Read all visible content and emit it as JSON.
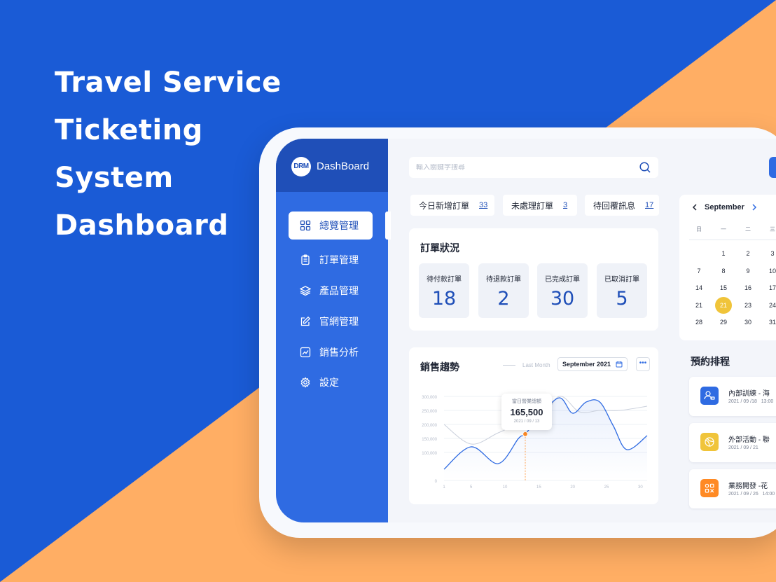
{
  "hero": {
    "lines": [
      "Travel  Service",
      "Ticketing",
      "System",
      "Dashboard"
    ]
  },
  "colors": {
    "primary": "#1A5BD6",
    "accent_orange": "#FFAE64",
    "sidebar": "#2F6BE2",
    "sidebar_header": "#1F4FB8",
    "highlight_yellow": "#F0C43A"
  },
  "sidebar": {
    "logo": "DRM",
    "brand": "DashBoard",
    "items": [
      {
        "label": "總覽管理",
        "icon": "grid-icon",
        "active": true
      },
      {
        "label": "訂單管理",
        "icon": "clipboard-icon",
        "active": false
      },
      {
        "label": "產品管理",
        "icon": "layers-icon",
        "active": false
      },
      {
        "label": "官網管理",
        "icon": "edit-icon",
        "active": false
      },
      {
        "label": "銷售分析",
        "icon": "chart-line-icon",
        "active": false
      },
      {
        "label": "設定",
        "icon": "gear-icon",
        "active": false
      }
    ]
  },
  "search": {
    "placeholder": "輸入關鍵字搜尋",
    "value": ""
  },
  "stats": [
    {
      "label": "今日新增訂單",
      "value": "33"
    },
    {
      "label": "未處理訂單",
      "value": "3"
    },
    {
      "label": "待回覆訊息",
      "value": "17"
    }
  ],
  "order_status": {
    "title": "訂單狀況",
    "items": [
      {
        "label": "待付款訂單",
        "value": "18"
      },
      {
        "label": "待退款訂單",
        "value": "2"
      },
      {
        "label": "已完成訂單",
        "value": "30"
      },
      {
        "label": "已取消訂單",
        "value": "5"
      }
    ]
  },
  "sales": {
    "title": "銷售趨勢",
    "legend": "Last Month",
    "month": "September  2021",
    "more": "•••",
    "tooltip": {
      "label": "當日營業總額",
      "value": "165,500",
      "date": "2021 / 09 / 13"
    }
  },
  "chart_data": {
    "type": "line",
    "x_ticks": [
      "1",
      "5",
      "10",
      "15",
      "20",
      "25",
      "30"
    ],
    "y_ticks": [
      "0",
      "100,000",
      "150,000",
      "200,000",
      "250,000",
      "300,000"
    ],
    "ylim": [
      0,
      300000
    ],
    "xlim": [
      1,
      31
    ],
    "series": [
      {
        "name": "",
        "color": "#2F6BE2",
        "x": [
          1,
          5,
          9,
          12,
          13,
          15,
          18,
          20,
          22,
          24,
          26,
          28,
          31
        ],
        "y": [
          40000,
          120000,
          60000,
          150000,
          165500,
          225000,
          295000,
          240000,
          280000,
          280000,
          195000,
          110000,
          160000
        ]
      },
      {
        "name": "Last Month",
        "color": "#C9CFDB",
        "x": [
          1,
          5,
          9,
          12,
          15,
          18,
          21,
          24,
          27,
          31
        ],
        "y": [
          200000,
          130000,
          170000,
          200000,
          200000,
          300000,
          245000,
          250000,
          250000,
          265000
        ]
      }
    ],
    "highlight": {
      "x": 13,
      "y": 165500
    }
  },
  "calendar": {
    "month": "September",
    "weekdays": [
      "日",
      "一",
      "二",
      "三"
    ],
    "weeks": [
      [
        "",
        "1",
        "2",
        "3"
      ],
      [
        "7",
        "8",
        "9",
        "10"
      ],
      [
        "14",
        "15",
        "16",
        "17"
      ],
      [
        "21",
        "21",
        "23",
        "24"
      ],
      [
        "28",
        "29",
        "30",
        "31"
      ]
    ],
    "selected": "21"
  },
  "schedule": {
    "title": "預約排程",
    "items": [
      {
        "title": "內部訓練 - 海",
        "date": "2021 / 09 /18",
        "time": "13:00",
        "icon": "users-icon",
        "color": "#2F6BE2"
      },
      {
        "title": "外部活動 - 聯",
        "date": "2021 / 09 / 21",
        "time": "",
        "icon": "ball-icon",
        "color": "#F0C43A"
      },
      {
        "title": "業務開發 -花",
        "date": "2021 / 09 / 26",
        "time": "14:00",
        "icon": "apps-icon",
        "color": "#FF8A24"
      }
    ]
  }
}
